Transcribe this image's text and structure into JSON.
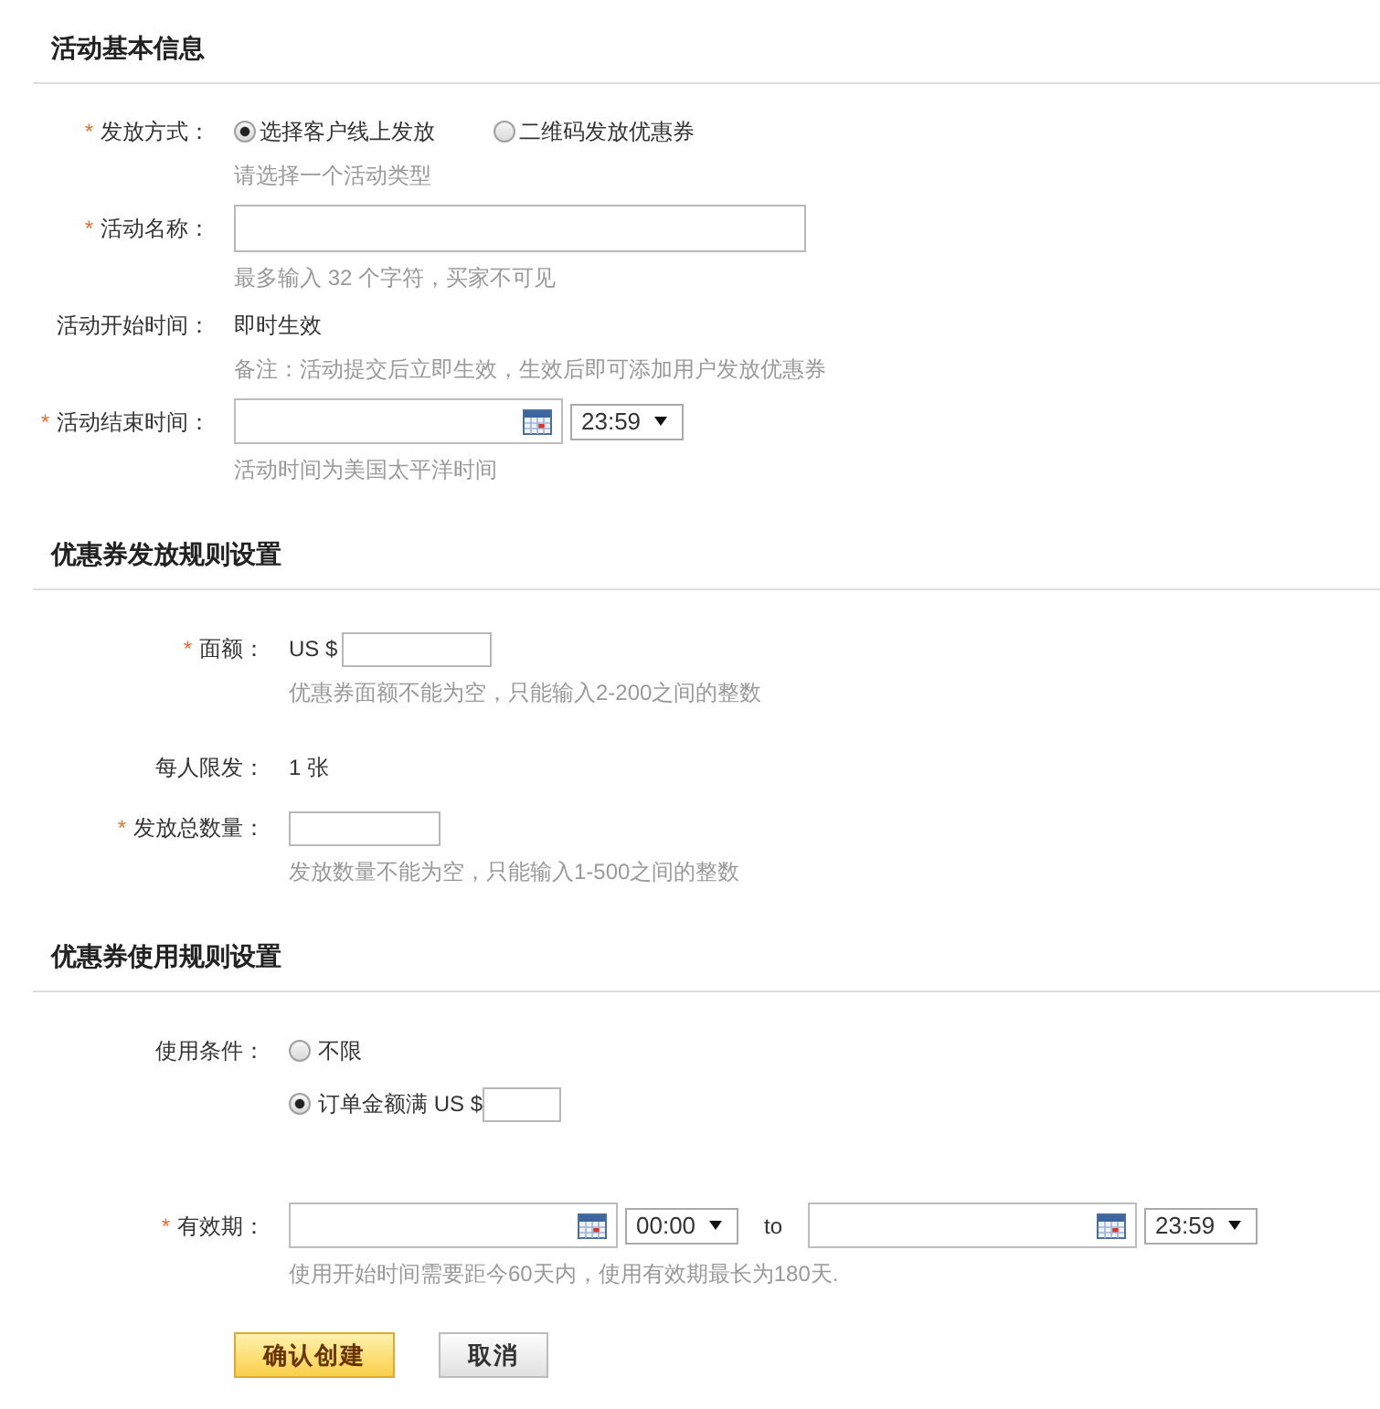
{
  "sections": [
    {
      "title": "活动基本信息",
      "fields": [
        {
          "kind": "radio-group",
          "required_mark": "*",
          "label": "发放方式：",
          "options": [
            {
              "label": "选择客户线上发放",
              "selected": true
            },
            {
              "label": "二维码发放优惠券",
              "selected": false
            }
          ],
          "hint": "请选择一个活动类型"
        },
        {
          "kind": "text-input",
          "required_mark": "*",
          "label": "活动名称：",
          "hint": "最多输入 32 个字符，买家不可见"
        },
        {
          "kind": "static",
          "label": "活动开始时间：",
          "value": "即时生效",
          "hint": "备注：活动提交后立即生效，生效后即可添加用户发放优惠券"
        },
        {
          "kind": "date-time",
          "required_mark": "*",
          "label": "活动结束时间：",
          "time": "23:59",
          "hint": "活动时间为美国太平洋时间"
        }
      ]
    },
    {
      "title": "优惠券发放规则设置",
      "fields": [
        {
          "kind": "money-input",
          "required_mark": "*",
          "label": "面额：",
          "prefix": "US $",
          "hint": "优惠券面额不能为空，只能输入2-200之间的整数"
        },
        {
          "kind": "static",
          "label": "每人限发：",
          "value": "1 张"
        },
        {
          "kind": "short-input",
          "required_mark": "*",
          "label": "发放总数量：",
          "hint": "发放数量不能为空，只能输入1-500之间的整数"
        }
      ]
    },
    {
      "title": "优惠券使用规则设置",
      "fields": [
        {
          "kind": "radio-list",
          "label": "使用条件：",
          "options": [
            {
              "kind": "plain",
              "label": "不限",
              "selected": false
            },
            {
              "kind": "amount",
              "label": "订单金额满 US $",
              "selected": true
            }
          ]
        },
        {
          "kind": "date-range",
          "required_mark": "*",
          "label": "有效期：",
          "start_time": "00:00",
          "separator": "to",
          "end_time": "23:59",
          "hint": "使用开始时间需要距今60天内，使用有效期最长为180天."
        }
      ]
    }
  ],
  "buttons": [
    {
      "kind": "primary",
      "label": "确认创建"
    },
    {
      "kind": "secondary",
      "label": "取消"
    }
  ]
}
